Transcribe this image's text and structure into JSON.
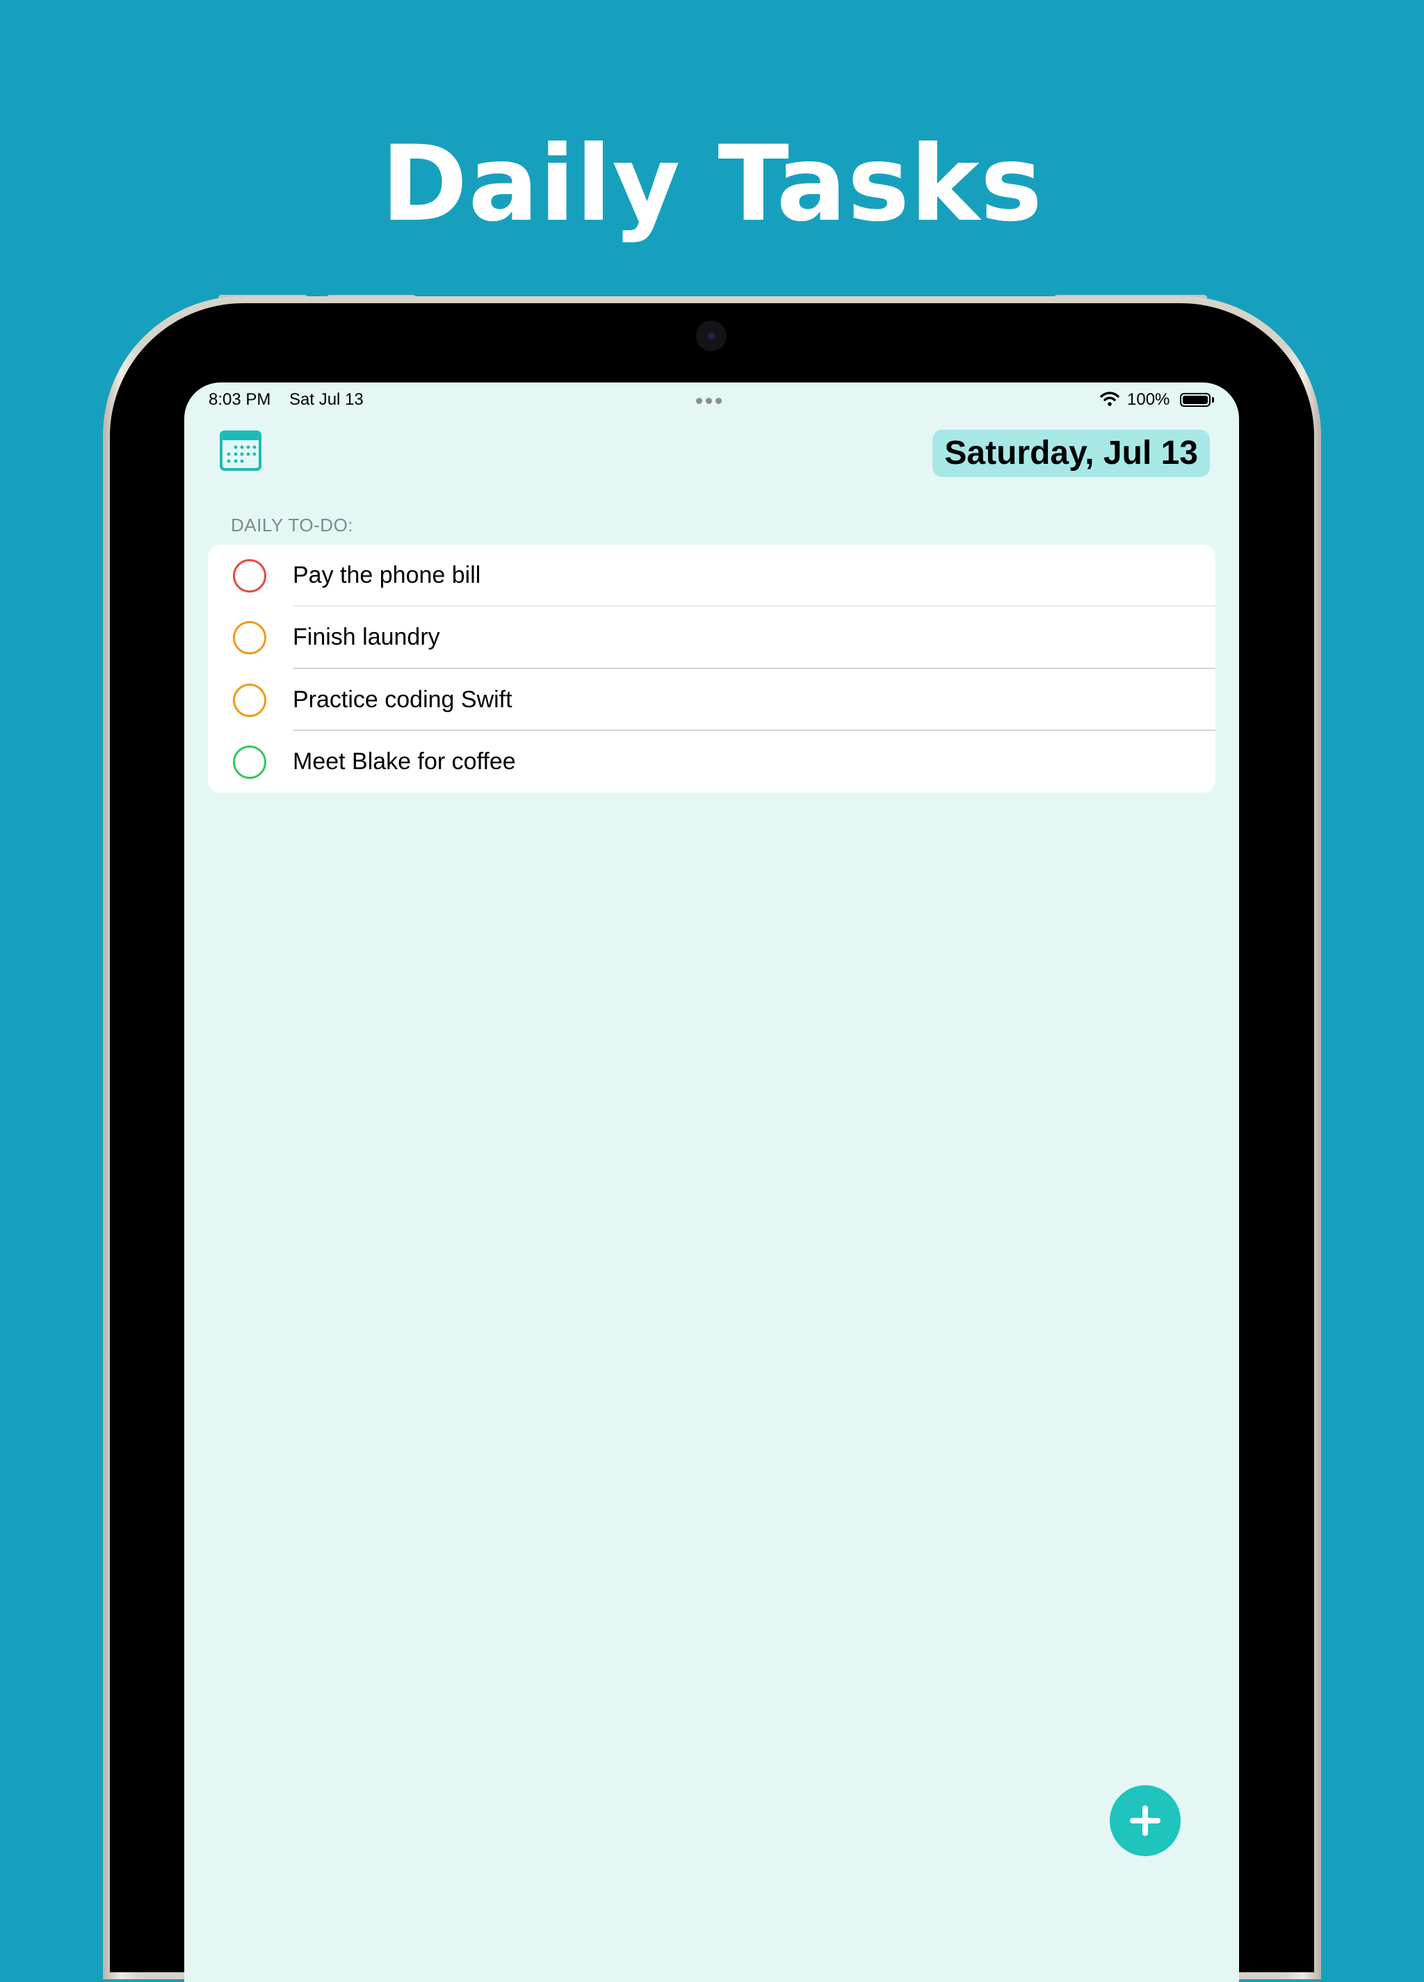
{
  "promo": {
    "headline": "Daily Tasks"
  },
  "status_bar": {
    "time": "8:03 PM",
    "date": "Sat Jul 13",
    "battery": "100%",
    "battery_level": 1.0,
    "wifi_icon": "wifi-icon"
  },
  "header": {
    "calendar_icon": "calendar-icon",
    "date_title": "Saturday, Jul 13"
  },
  "section": {
    "label": "DAILY TO-DO:"
  },
  "tasks": [
    {
      "label": "Pay the phone bill",
      "color": "#e84a43",
      "completed": false
    },
    {
      "label": "Finish laundry",
      "color": "#f09a1c",
      "completed": false
    },
    {
      "label": "Practice coding Swift",
      "color": "#f09a1c",
      "completed": false
    },
    {
      "label": "Meet Blake for coffee",
      "color": "#34c760",
      "completed": false
    }
  ],
  "fab": {
    "icon": "plus-icon"
  },
  "colors": {
    "page_background": "#17a0bd",
    "screen_background": "#e4f7f5",
    "accent": "#1ec4bd",
    "date_pill": "#a7e8e6"
  }
}
